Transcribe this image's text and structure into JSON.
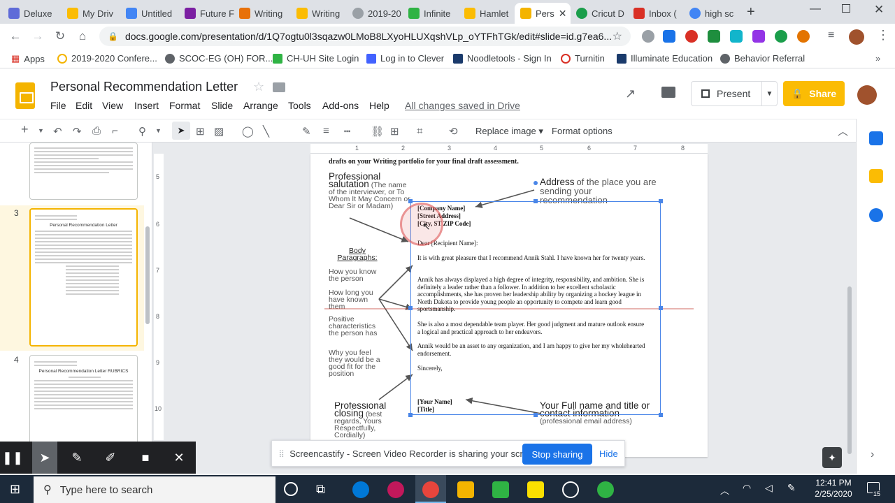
{
  "tabs": [
    {
      "label": "Deluxe",
      "color": "#5f6bd8"
    },
    {
      "label": "My Driv",
      "color": "#fbbc04"
    },
    {
      "label": "Untitled",
      "color": "#4285f4"
    },
    {
      "label": "Future F",
      "color": "#7b1fa2"
    },
    {
      "label": "Writing",
      "color": "#e8710a"
    },
    {
      "label": "Writing",
      "color": "#fbbc04"
    },
    {
      "label": "2019-20",
      "color": "#9aa0a6"
    },
    {
      "label": "Infinite",
      "color": "#2fb344"
    },
    {
      "label": "Hamlet",
      "color": "#fbbc04"
    },
    {
      "label": "Pers",
      "color": "#f4b400"
    },
    {
      "label": "Cricut D",
      "color": "#1b9e4b"
    },
    {
      "label": "Inbox (",
      "color": "#d93025"
    },
    {
      "label": "high sc",
      "color": "#4285f4"
    }
  ],
  "url": "docs.google.com/presentation/d/1Q7ogtu0l3sqazw0LMoB8LXyoHLUXqshVLp_oYTFhTGk/edit#slide=id.g7ea6...",
  "bookmarks": [
    "Apps",
    "2019-2020 Confere...",
    "SCOC-EG (OH) FOR...",
    "CH-UH Site Login",
    "Log in to Clever",
    "Noodletools - Sign In",
    "Turnitin",
    "Illuminate Education",
    "Behavior Referral"
  ],
  "doc": {
    "title": "Personal Recommendation Letter",
    "saved": "All changes saved in Drive"
  },
  "menus": [
    "File",
    "Edit",
    "View",
    "Insert",
    "Format",
    "Slide",
    "Arrange",
    "Tools",
    "Add-ons",
    "Help"
  ],
  "buttons": {
    "present": "Present",
    "share": "Share"
  },
  "toolbar": {
    "replace_image": "Replace image",
    "format_options": "Format options"
  },
  "filmstrip": {
    "slide3_num": "3",
    "slide4_num": "4",
    "slide3_title": "Personal Recommendation Letter",
    "slide4_title": "Personal Recommendation Letter RUBRICS"
  },
  "ruler": [
    "1",
    "2",
    "3",
    "4",
    "5",
    "6",
    "7",
    "8"
  ],
  "vruler": [
    "5",
    "6",
    "7",
    "8",
    "9",
    "10"
  ],
  "slide": {
    "top_text": "drafts on your Writing portfolio for your final draft assessment.",
    "ann_salutation_title": "Professional salutation",
    "ann_salutation_body": "(The name of the interviewer, or To Whom It May Concern or Dear Sir or Madam)",
    "ann_address_title": "Address",
    "ann_address_body": "of the place you are sending your recommendation",
    "ann_body_title": "Body Paragraphs:",
    "ann_know": "How you know the person",
    "ann_howlong": "How long you have known them",
    "ann_positive": "Positive characteristics the person has",
    "ann_fit": "Why you feel they would be a good fit for the position",
    "ann_closing_title": "Professional closing",
    "ann_closing_body": "(best regards, Yours Respectfully, Cordially)",
    "ann_name_title": "Your Full name and title or contact information",
    "ann_name_body": "(professional email address)",
    "letter_company": "[Company Name]",
    "letter_street": "[Street Address]",
    "letter_city": "[City, ST  ZIP Code]",
    "letter_dear": "Dear [Recipient Name]:",
    "letter_p1": "It is with great pleasure that I recommend Annik Stahl. I have known her for twenty years.",
    "letter_p2": "Annik has always displayed a high degree of integrity, responsibility, and ambition. She is definitely a leader rather than a follower. In addition to her excellent scholastic accomplishments, she has proven her leadership ability by organizing a hockey league in North Dakota to provide young people an opportunity to compete and learn good sportsmanship.",
    "letter_p3": "She is also a most dependable team player. Her good judgment and mature outlook ensure a logical and practical approach to her endeavors.",
    "letter_p4": "Annik would be an asset to any organization, and I am happy to give her my wholehearted endorsement.",
    "letter_sincerely": "Sincerely,",
    "letter_name": "[Your Name]",
    "letter_title": "[Title]"
  },
  "screencastify": {
    "notice": "Screencastify - Screen Video Recorder is sharing your screen.",
    "stop": "Stop sharing",
    "hide": "Hide"
  },
  "taskbar": {
    "search_placeholder": "Type here to search",
    "time": "12:41 PM",
    "date": "2/25/2020",
    "notif": "15"
  }
}
